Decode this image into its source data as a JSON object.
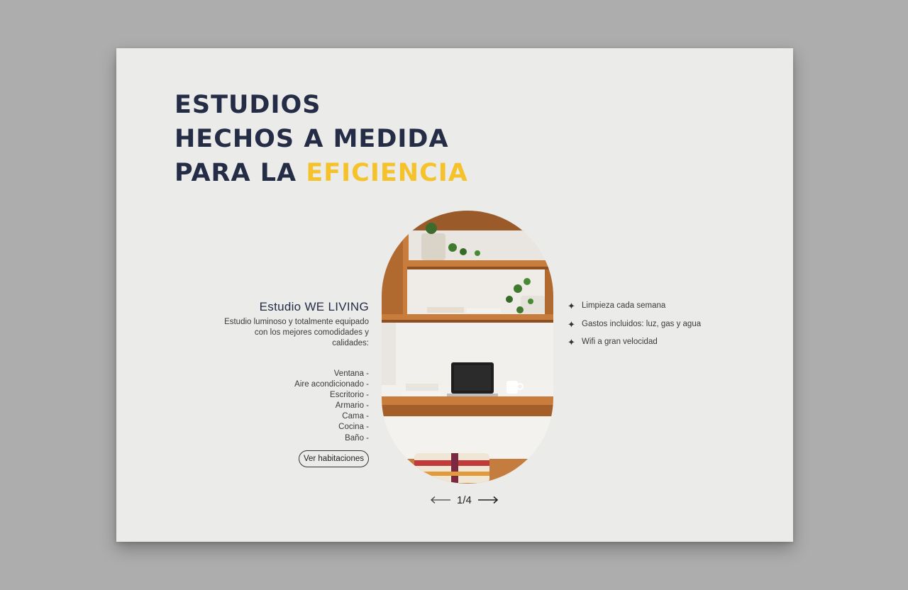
{
  "headline": {
    "line1": "ESTUDIOS",
    "line2": "HECHOS A MEDIDA",
    "line3_prefix": "PARA LA ",
    "line3_accent": "EFICIENCIA"
  },
  "studio": {
    "title": "Estudio WE LIVING",
    "description": "Estudio luminoso y totalmente equipado con los mejores comodidades y calidades:",
    "features": [
      "Ventana -",
      "Aire acondicionado -",
      "Escritorio -",
      "Armario -",
      "Cama -",
      "Cocina -",
      "Baño -"
    ],
    "button_label": "Ver habitaciones"
  },
  "perks": [
    {
      "icon": "sparkle-icon",
      "label": "Limpieza cada semana"
    },
    {
      "icon": "sparkle-icon",
      "label": "Gastos incluidos: luz, gas y agua"
    },
    {
      "icon": "sparkle-icon",
      "label": "Wifi a gran velocidad"
    }
  ],
  "pager": {
    "current": "1",
    "total": "4",
    "text": "1/4"
  },
  "colors": {
    "navy": "#252c46",
    "accent": "#f6c22b",
    "card": "#ebebe9",
    "backdrop": "#adadad"
  }
}
